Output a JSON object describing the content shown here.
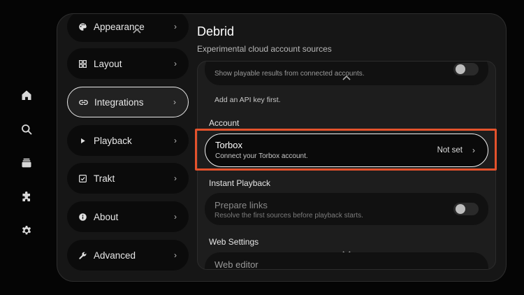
{
  "rail": {
    "icons": [
      "home-icon",
      "search-icon",
      "library-icon",
      "puzzle-icon",
      "gear-icon"
    ]
  },
  "nav": {
    "items": [
      {
        "label": "Appearance",
        "icon": "palette-icon"
      },
      {
        "label": "Layout",
        "icon": "grid-icon"
      },
      {
        "label": "Integrations",
        "icon": "link-icon"
      },
      {
        "label": "Playback",
        "icon": "play-icon"
      },
      {
        "label": "Trakt",
        "icon": "check-box-icon"
      },
      {
        "label": "About",
        "icon": "info-icon"
      },
      {
        "label": "Advanced",
        "icon": "wrench-icon"
      }
    ],
    "chevron": "›"
  },
  "header": {
    "title": "Debrid",
    "subtitle": "Experimental cloud account sources"
  },
  "content": {
    "top_card_desc": "Show playable results from connected accounts.",
    "hint": "Add an API key first.",
    "account_label": "Account",
    "torbox": {
      "title": "Torbox",
      "desc": "Connect your Torbox account.",
      "value": "Not set",
      "chevron": "›"
    },
    "instant_label": "Instant Playback",
    "prepare": {
      "title": "Prepare links",
      "desc": "Resolve the first sources before playback starts."
    },
    "web_label": "Web Settings",
    "web_editor": {
      "title": "Web editor"
    }
  },
  "colors": {
    "highlight": "#e4522c",
    "background": "#050505",
    "panel": "#161616"
  }
}
